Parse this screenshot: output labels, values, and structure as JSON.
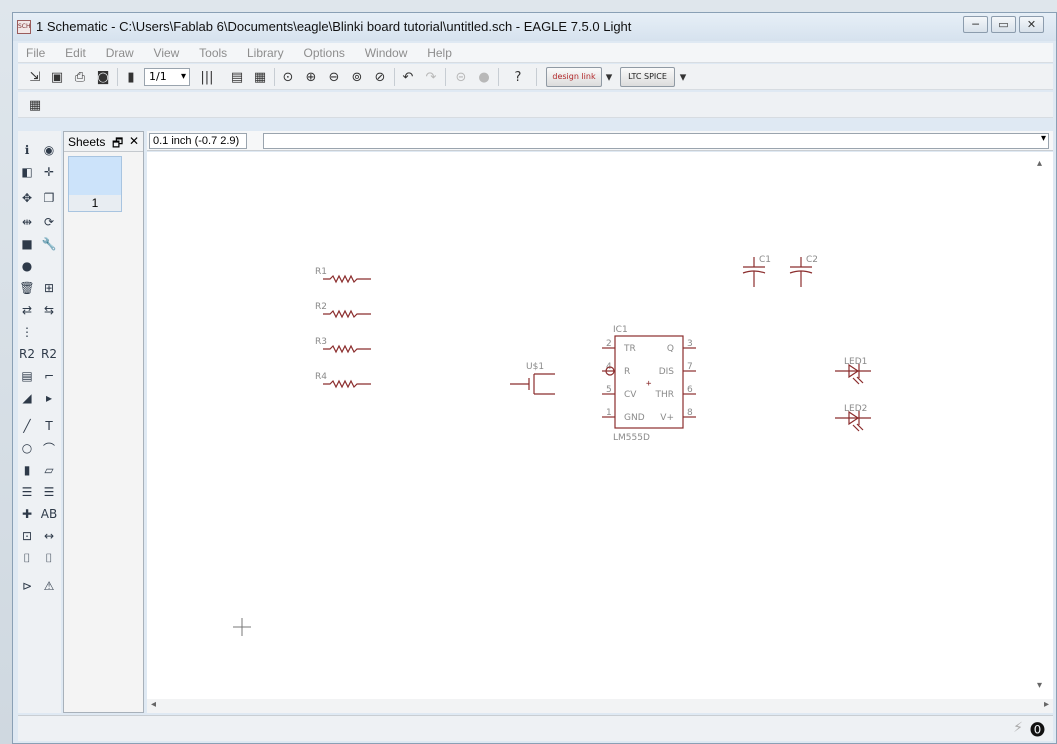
{
  "window": {
    "title": "1 Schematic - C:\\Users\\Fablab 6\\Documents\\eagle\\Blinki board tutorial\\untitled.sch - EAGLE 7.5.0 Light",
    "icon_label": "SCH",
    "minimize": "─",
    "restore": "▭",
    "close": "✕"
  },
  "menu": [
    "File",
    "Edit",
    "Draw",
    "View",
    "Tools",
    "Library",
    "Options",
    "Window",
    "Help"
  ],
  "toolbar": {
    "sheet_value": "1/1",
    "designlink_label": "design link",
    "ltspice_label": "LTC SPICE",
    "help_icon": "?"
  },
  "sheets_panel": {
    "title": "Sheets",
    "sheet_number": "1"
  },
  "coordinate": "0.1 inch (-0.7 2.9)",
  "schematic": {
    "resistors": [
      "R1",
      "R2",
      "R3",
      "R4"
    ],
    "capacitors": [
      "C1",
      "C2"
    ],
    "ic": {
      "name": "IC1",
      "value": "LM555D",
      "left_pins": [
        {
          "num": "2",
          "name": "TR"
        },
        {
          "num": "4",
          "name": "R"
        },
        {
          "num": "5",
          "name": "CV"
        },
        {
          "num": "1",
          "name": "GND"
        }
      ],
      "right_pins": [
        {
          "num": "3",
          "name": "Q"
        },
        {
          "num": "7",
          "name": "DIS"
        },
        {
          "num": "6",
          "name": "THR"
        },
        {
          "num": "8",
          "name": "V+"
        }
      ]
    },
    "switch": "U$1",
    "leds": [
      "LED1",
      "LED2"
    ]
  }
}
